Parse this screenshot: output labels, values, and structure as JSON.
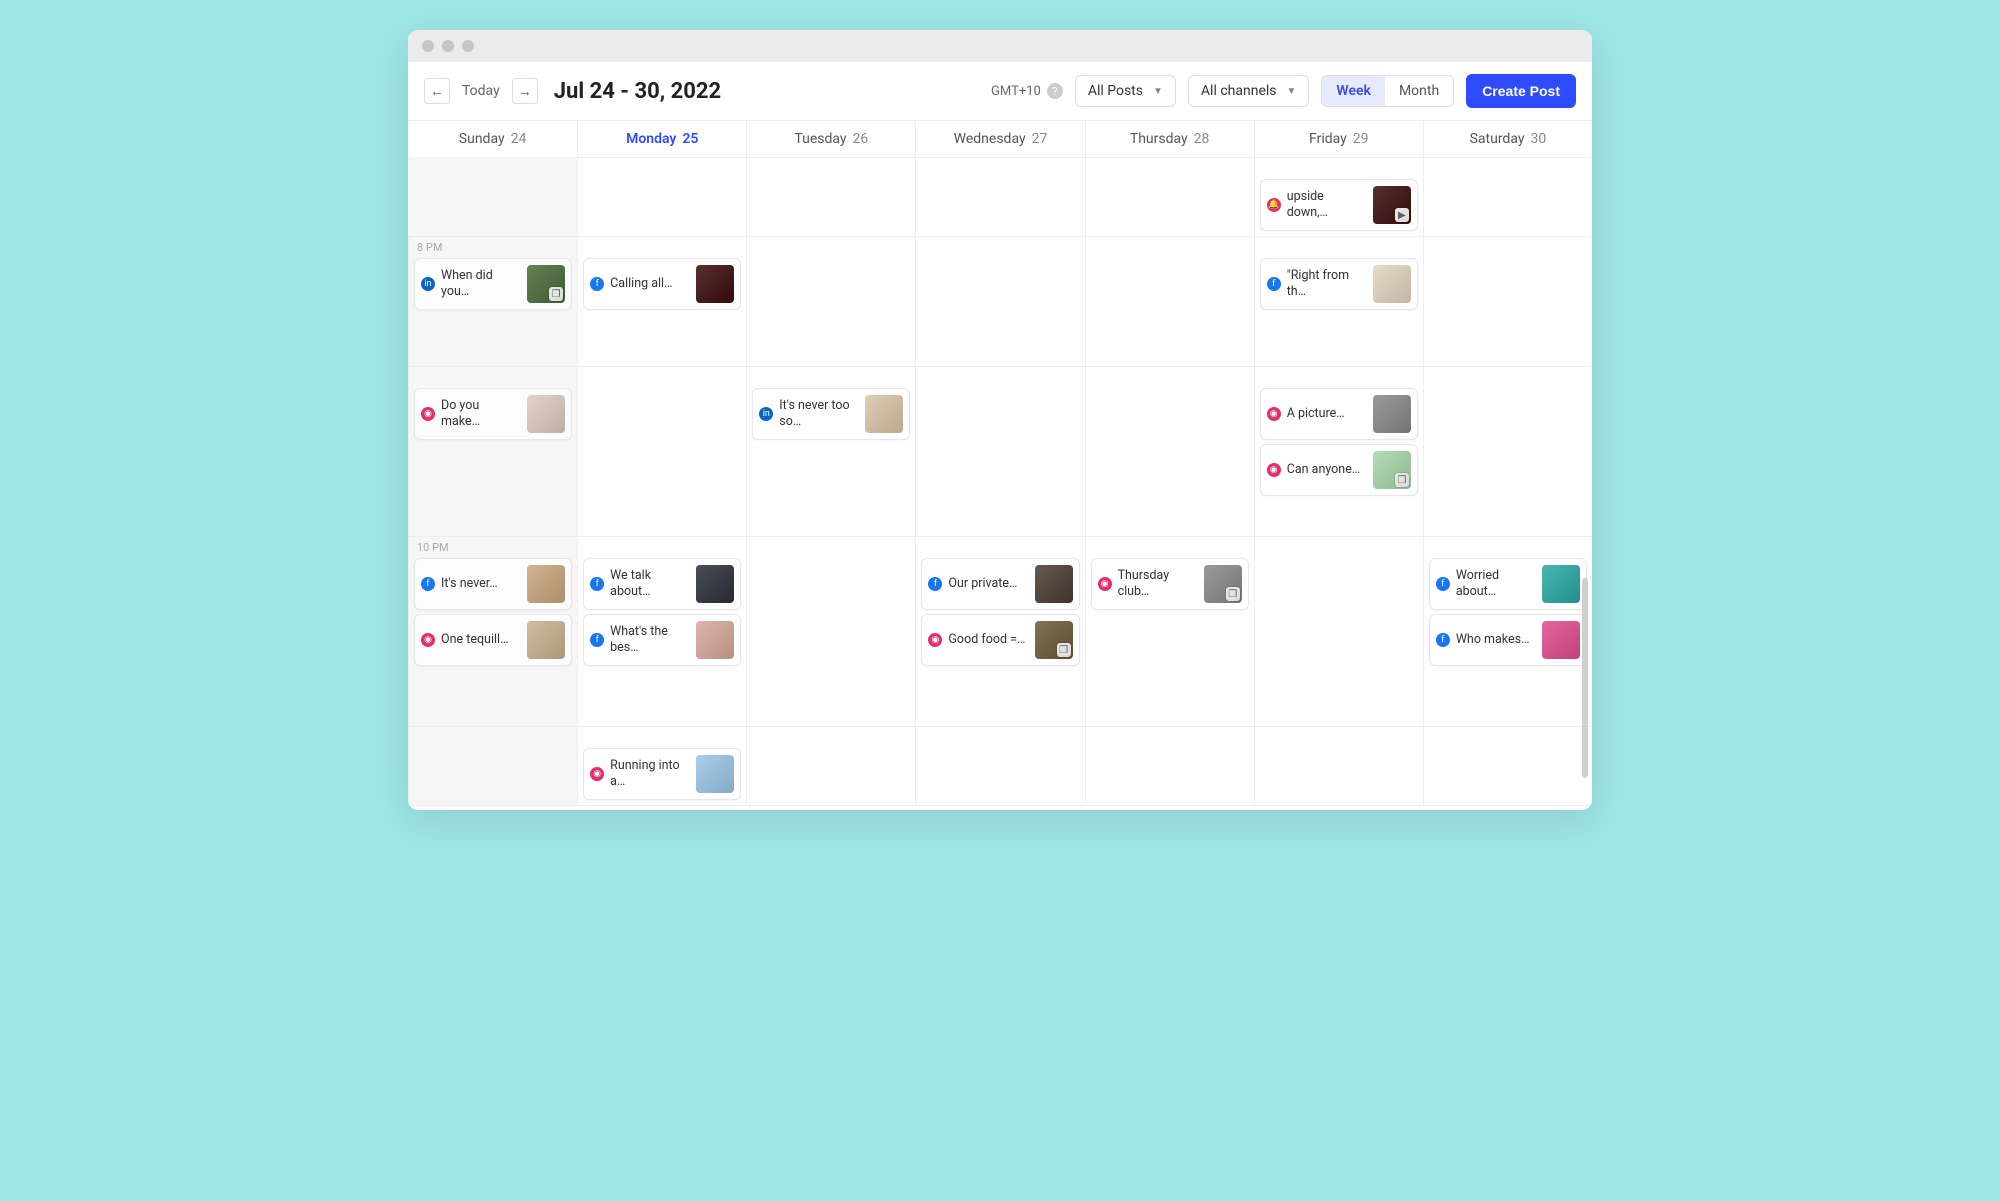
{
  "toolbar": {
    "today": "Today",
    "date_range": "Jul 24 - 30, 2022",
    "timezone": "GMT+10",
    "filter_posts": "All Posts",
    "filter_channels": "All channels",
    "view_week": "Week",
    "view_month": "Month",
    "create": "Create Post"
  },
  "days": [
    {
      "dow": "Sunday",
      "num": "24"
    },
    {
      "dow": "Monday",
      "num": "25"
    },
    {
      "dow": "Tuesday",
      "num": "26"
    },
    {
      "dow": "Wednesday",
      "num": "27"
    },
    {
      "dow": "Thursday",
      "num": "28"
    },
    {
      "dow": "Friday",
      "num": "29"
    },
    {
      "dow": "Saturday",
      "num": "30"
    }
  ],
  "today_index": 1,
  "time_labels": {
    "r1": "8 PM",
    "r3": "10 PM"
  },
  "rows": [
    {
      "cells": [
        [],
        [],
        [],
        [],
        [],
        [
          {
            "ch": "bell",
            "text": "upside down,…",
            "thumb": "t-red",
            "overlay": "video"
          }
        ],
        []
      ]
    },
    {
      "cells": [
        [
          {
            "ch": "li",
            "text": "When did you…",
            "thumb": "t-nature",
            "overlay": "stack"
          }
        ],
        [
          {
            "ch": "fb",
            "text": "Calling all…",
            "thumb": "t-red"
          }
        ],
        [],
        [],
        [],
        [
          {
            "ch": "fb",
            "text": "\"Right from th…",
            "thumb": "t-family"
          }
        ],
        []
      ]
    },
    {
      "cells": [
        [
          {
            "ch": "ig",
            "text": "Do you make…",
            "thumb": "t-girls"
          }
        ],
        [],
        [
          {
            "ch": "li",
            "text": "It's never too so…",
            "thumb": "t-people"
          }
        ],
        [],
        [],
        [
          {
            "ch": "ig",
            "text": "A picture…",
            "thumb": "t-bw"
          },
          {
            "ch": "ig",
            "text": "Can anyone…",
            "thumb": "t-green",
            "overlay": "stack"
          }
        ],
        []
      ]
    },
    {
      "cells": [
        [
          {
            "ch": "fb",
            "text": "It's never…",
            "thumb": "t-friends"
          },
          {
            "ch": "ig",
            "text": "One tequill…",
            "thumb": "t-building"
          }
        ],
        [
          {
            "ch": "fb",
            "text": "We talk about…",
            "thumb": "t-dark"
          },
          {
            "ch": "fb",
            "text": "What's the bes…",
            "thumb": "t-shop"
          }
        ],
        [],
        [
          {
            "ch": "fb",
            "text": "Our private…",
            "thumb": "t-bar"
          },
          {
            "ch": "ig",
            "text": "Good food =…",
            "thumb": "t-food",
            "overlay": "stack"
          }
        ],
        [
          {
            "ch": "ig",
            "text": "Thursday club…",
            "thumb": "t-bw",
            "overlay": "stack"
          }
        ],
        [],
        [
          {
            "ch": "fb",
            "text": "Worried about…",
            "thumb": "t-pool"
          },
          {
            "ch": "fb",
            "text": "Who makes…",
            "thumb": "t-pink"
          }
        ]
      ]
    },
    {
      "cells": [
        [],
        [
          {
            "ch": "ig",
            "text": "Running into a…",
            "thumb": "t-sky"
          }
        ],
        [],
        [],
        [],
        [],
        []
      ]
    }
  ]
}
